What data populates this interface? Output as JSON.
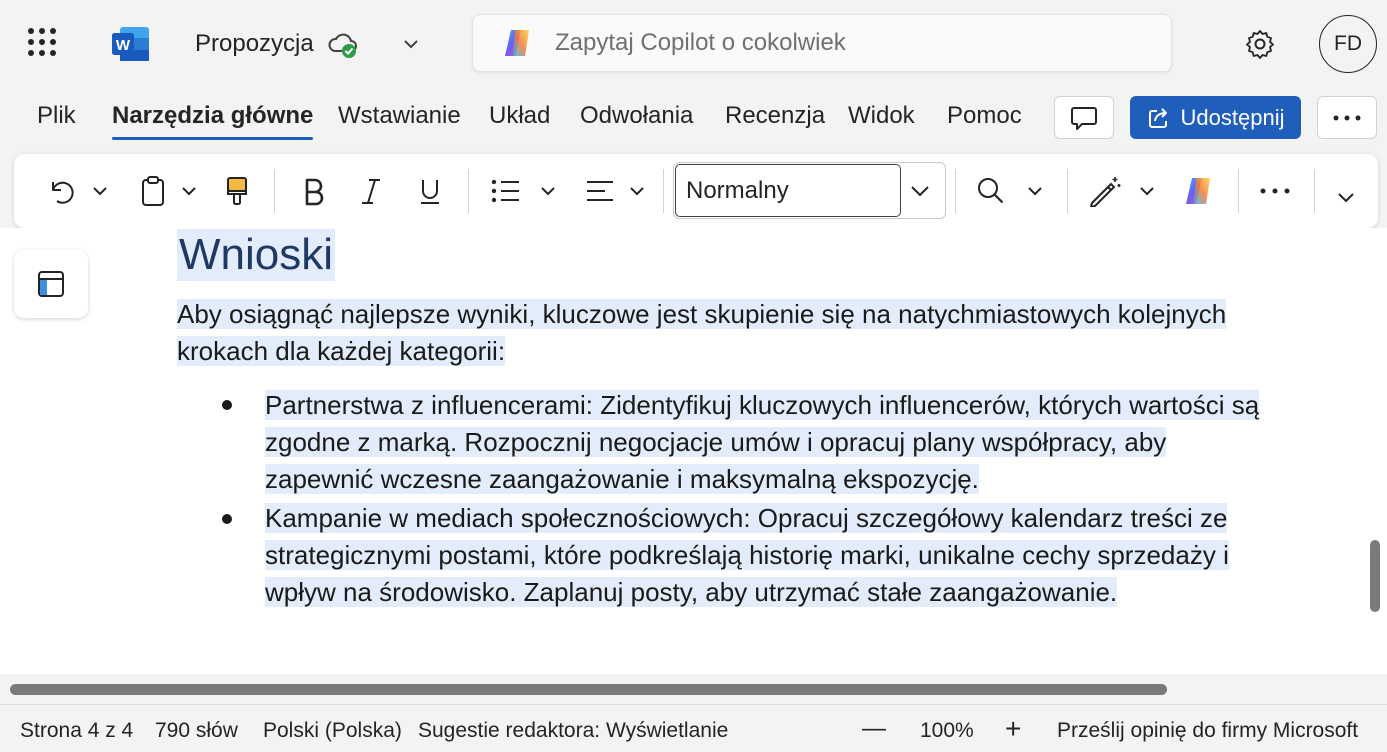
{
  "app": {
    "document_title": "Propozycja",
    "copilot_placeholder": "Zapytaj Copilot o cokolwiek",
    "avatar_initials": "FD"
  },
  "tabs": [
    {
      "label": "Plik"
    },
    {
      "label": "Narzędzia główne",
      "active": true
    },
    {
      "label": "Wstawianie"
    },
    {
      "label": "Układ"
    },
    {
      "label": "Odwołania"
    },
    {
      "label": "Recenzja"
    },
    {
      "label": "Widok"
    },
    {
      "label": "Pomoc"
    }
  ],
  "actions": {
    "share_label": "Udostępnij"
  },
  "ribbon": {
    "style_value": "Normalny",
    "icons": [
      "undo-icon",
      "paste-icon",
      "format-painter-icon",
      "bold-icon",
      "italic-icon",
      "underline-icon",
      "bullets-icon",
      "align-icon",
      "find-icon",
      "editor-icon",
      "copilot-icon",
      "more-icon"
    ]
  },
  "document": {
    "heading": "Wnioski",
    "intro_lines": [
      "Aby osiągnąć najlepsze wyniki, kluczowe jest skupienie się na natychmiastowych kolejnych",
      "krokach dla każdej kategorii:"
    ],
    "bullets": [
      {
        "lines": [
          "Partnerstwa z influencerami: Zidentyfikuj kluczowych influencerów, których wartości są",
          "zgodne z marką. Rozpocznij negocjacje umów i opracuj plany współpracy, aby",
          "zapewnić wczesne zaangażowanie i maksymalną ekspozycję."
        ]
      },
      {
        "lines": [
          "Kampanie w mediach społecznościowych: Opracuj szczegółowy kalendarz treści ze",
          "strategicznymi postami, które podkreślają historię marki, unikalne cechy sprzedaży i",
          "wpływ na środowisko. Zaplanuj posty, aby utrzymać stałe zaangażowanie."
        ]
      }
    ]
  },
  "statusbar": {
    "page": "Strona 4 z 4",
    "words": "790 słów",
    "language": "Polski (Polska)",
    "editor_suggestions": "Sugestie redaktora: Wyświetlanie",
    "zoom_out": "—",
    "zoom": "100%",
    "zoom_in": "+",
    "feedback": "Prześlij opinię do firmy Microsoft"
  },
  "colors": {
    "accent": "#1f5fbb",
    "heading": "#1f3864",
    "highlight": "#e3ecfb"
  }
}
